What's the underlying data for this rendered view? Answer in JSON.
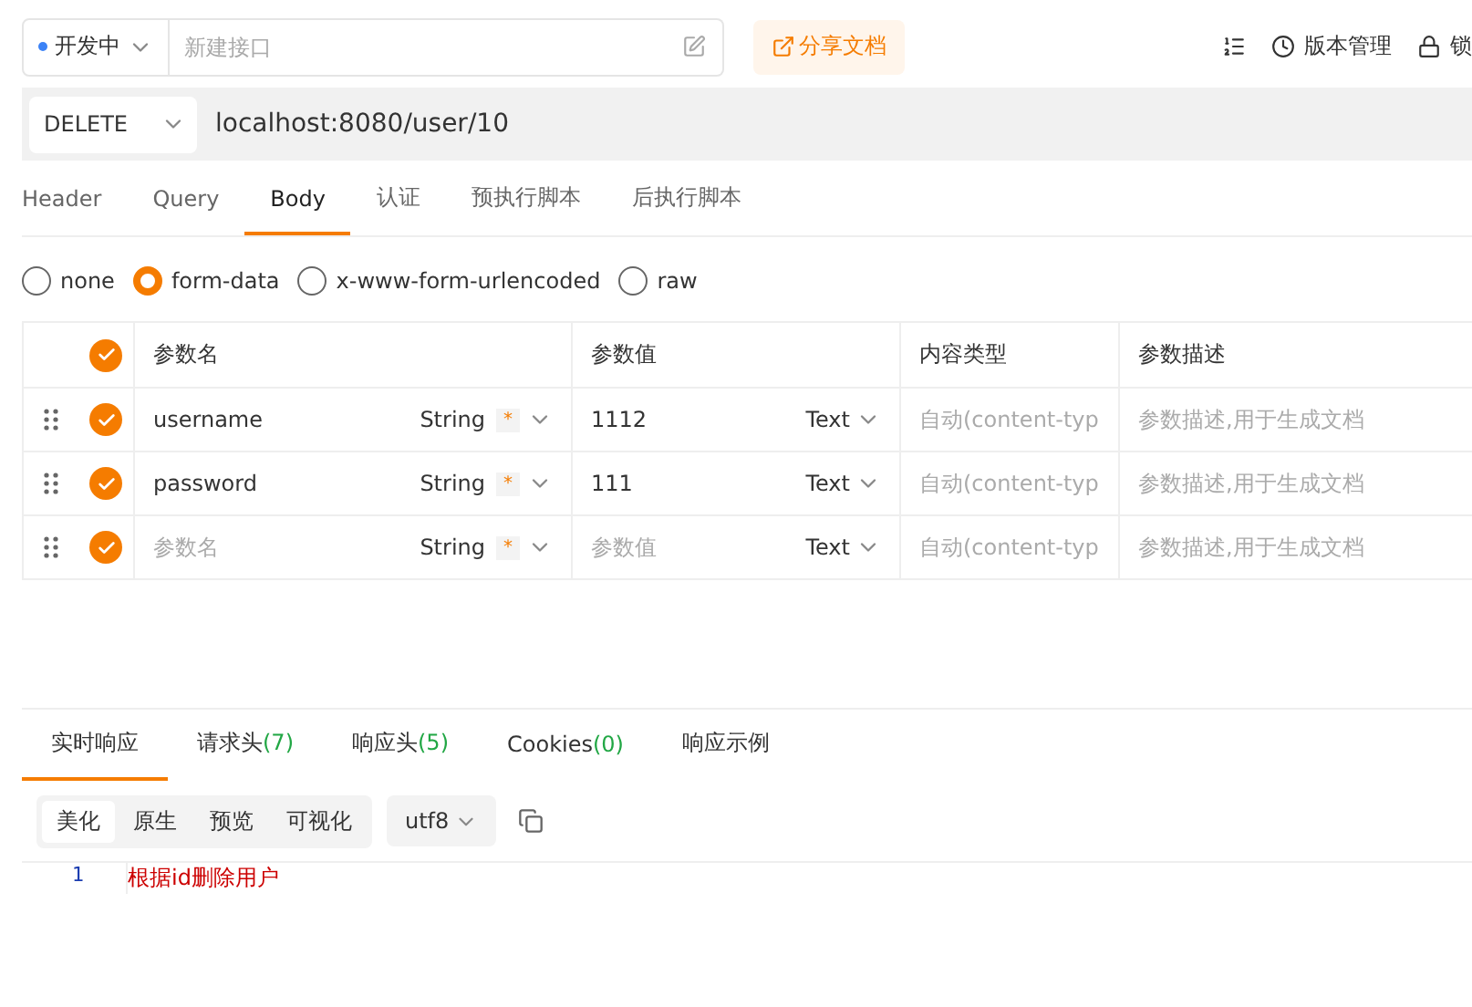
{
  "top_bar": {
    "env": {
      "label": "开发中",
      "color": "#3b82f6"
    },
    "name_field": {
      "placeholder": "新建接口"
    },
    "share_button": "分享文档",
    "actions": [
      {
        "kind": "outline"
      },
      {
        "kind": "clock",
        "label": "版本管理"
      },
      {
        "kind": "lock",
        "label": "锁"
      }
    ]
  },
  "request": {
    "method": "DELETE",
    "url": "localhost:8080/user/10"
  },
  "tabs": [
    {
      "label": "Header",
      "selected": false
    },
    {
      "label": "Query",
      "selected": false
    },
    {
      "label": "Body",
      "selected": true
    },
    {
      "label": "认证",
      "selected": false
    },
    {
      "label": "预执行脚本",
      "selected": false
    },
    {
      "label": "后执行脚本",
      "selected": false
    }
  ],
  "body_types": [
    {
      "label": "none",
      "selected": false
    },
    {
      "label": "form-data",
      "selected": true
    },
    {
      "label": "x-www-form-urlencoded",
      "selected": false
    },
    {
      "label": "raw",
      "selected": false
    }
  ],
  "table": {
    "all_checked": true,
    "columns": [
      "参数名",
      "参数值",
      "内容类型",
      "参数描述"
    ],
    "rows": [
      {
        "checked": true,
        "name": "username",
        "name_placeholder": false,
        "type": "String",
        "required": "*",
        "value": "1112",
        "value_placeholder": false,
        "value_type": "Text",
        "content_type": "自动(content-typ",
        "description": "参数描述,用于生成文档"
      },
      {
        "checked": true,
        "name": "password",
        "name_placeholder": false,
        "type": "String",
        "required": "*",
        "value": "111",
        "value_placeholder": false,
        "value_type": "Text",
        "content_type": "自动(content-typ",
        "description": "参数描述,用于生成文档"
      },
      {
        "checked": true,
        "name": "参数名",
        "name_placeholder": true,
        "type": "String",
        "required": "*",
        "value": "参数值",
        "value_placeholder": true,
        "value_type": "Text",
        "content_type": "自动(content-typ",
        "description": "参数描述,用于生成文档"
      }
    ]
  },
  "response_tabs": [
    {
      "label": "实时响应",
      "selected": true
    },
    {
      "label": "请求头",
      "count": "(7)",
      "selected": false
    },
    {
      "label": "响应头",
      "count": "(5)",
      "selected": false
    },
    {
      "label": "Cookies",
      "count": "(0)",
      "selected": false
    },
    {
      "label": "响应示例",
      "selected": false
    }
  ],
  "view_modes": [
    {
      "label": "美化",
      "selected": true
    },
    {
      "label": "原生",
      "selected": false
    },
    {
      "label": "预览",
      "selected": false
    },
    {
      "label": "可视化",
      "selected": false
    }
  ],
  "encoding": "utf8",
  "code_lines": [
    {
      "number": "1",
      "text": "根据id删除用户"
    }
  ]
}
